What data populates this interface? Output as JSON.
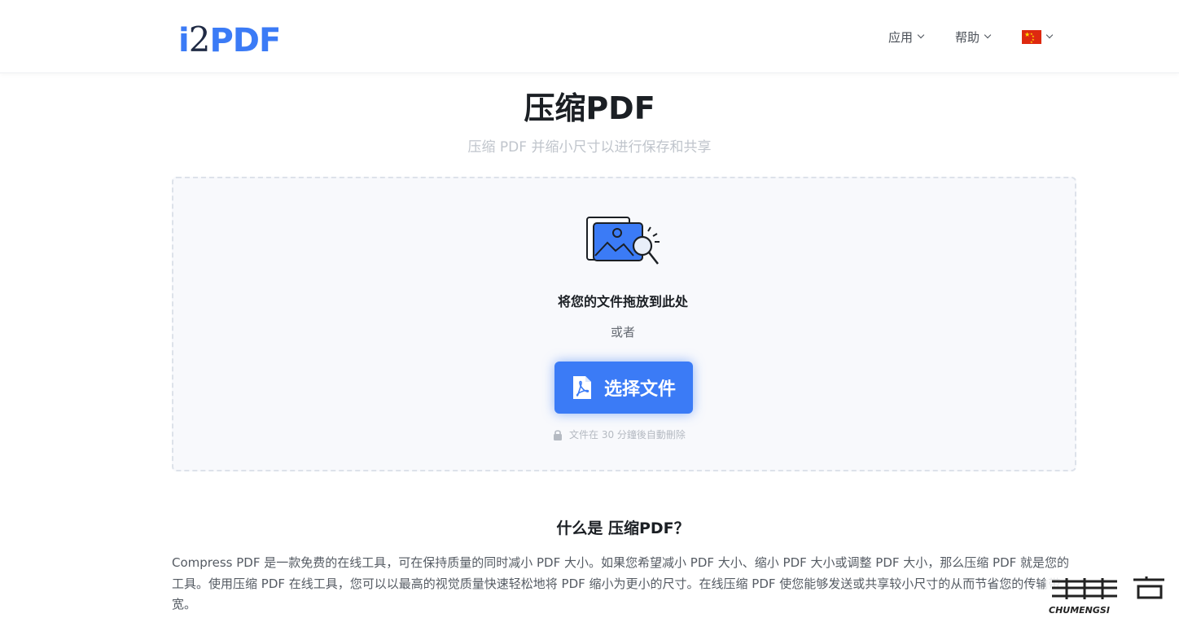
{
  "header": {
    "logo": {
      "i": "i",
      "two": "2",
      "pdf": "PDF"
    },
    "nav": [
      {
        "label": "应用"
      },
      {
        "label": "帮助"
      }
    ],
    "language_flag": "cn-flag-icon"
  },
  "main": {
    "title": "压缩PDF",
    "subtitle": "压缩 PDF 并缩小尺寸以进行保存和共享",
    "dropzone": {
      "drop_text": "将您的文件拖放到此处",
      "or_text": "或者",
      "choose_button": "选择文件",
      "note": "文件在 30 分鐘後自動刪除"
    },
    "section": {
      "title": "什么是 压缩PDF？",
      "paragraph": "Compress PDF 是一款免费的在线工具，可在保持质量的同时减小 PDF 大小。如果您希望减小 PDF 大小、缩小 PDF 大小或调整 PDF 大小，那么压缩 PDF 就是您的工具。使用压缩 PDF 在线工具，您可以以最高的视觉质量快速轻松地将 PDF 缩小为更小的尺寸。在线压缩 PDF 使您能够发送或共享较小尺寸的从而节省您的传输带宽。"
    }
  },
  "watermark": {
    "text": "CHUMENGSI"
  },
  "colors": {
    "accent": "#3b7bf6",
    "dropzone_bg": "#f8f9fc",
    "flag_red": "#de2910",
    "flag_yellow": "#ffde00"
  }
}
